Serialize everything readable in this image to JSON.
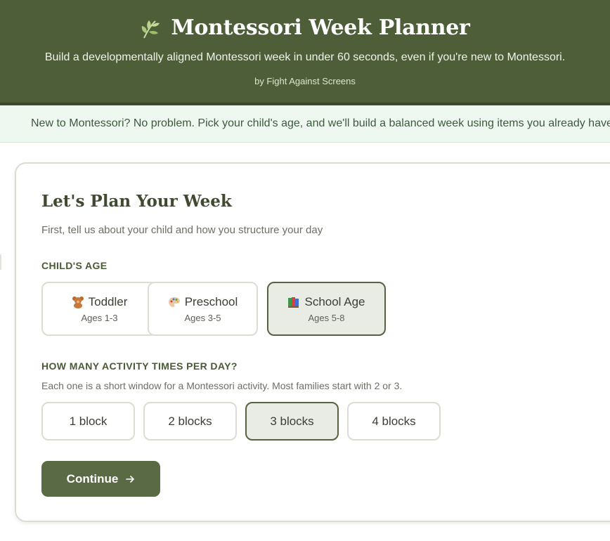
{
  "header": {
    "title": "Montessori Week Planner",
    "subtitle": "Build a developmentally aligned Montessori week in under 60 seconds, even if you're new to Montessori.",
    "byline": "by Fight Against Screens",
    "icon": "leaf-icon"
  },
  "banner": {
    "text": "New to Montessori? No problem. Pick your child's age, and we'll build a balanced week using items you already have"
  },
  "card": {
    "title": "Let's Plan Your Week",
    "subtitle": "First, tell us about your child and how you structure your day",
    "age_label": "CHILD'S AGE",
    "age_options": [
      {
        "icon": "teddy-bear-icon",
        "label": "Toddler",
        "sub": "Ages 1-3",
        "selected": false
      },
      {
        "icon": "palette-icon",
        "label": "Preschool",
        "sub": "Ages 3-5",
        "selected": false
      },
      {
        "icon": "books-icon",
        "label": "School Age",
        "sub": "Ages 5-8",
        "selected": true
      }
    ],
    "blocks_label": "HOW MANY ACTIVITY TIMES PER DAY?",
    "blocks_help": "Each one is a short window for a Montessori activity. Most families start with 2 or 3.",
    "block_options": [
      {
        "label": "1 block",
        "selected": false
      },
      {
        "label": "2 blocks",
        "selected": false
      },
      {
        "label": "3 blocks",
        "selected": true
      },
      {
        "label": "4 blocks",
        "selected": false
      }
    ],
    "continue_label": "Continue",
    "continue_icon": "arrow-right-icon"
  },
  "colors": {
    "header_bg": "#4e5e39",
    "banner_bg": "#eef8f1",
    "accent": "#5a6a44",
    "selected_bg": "#e9ece5"
  }
}
